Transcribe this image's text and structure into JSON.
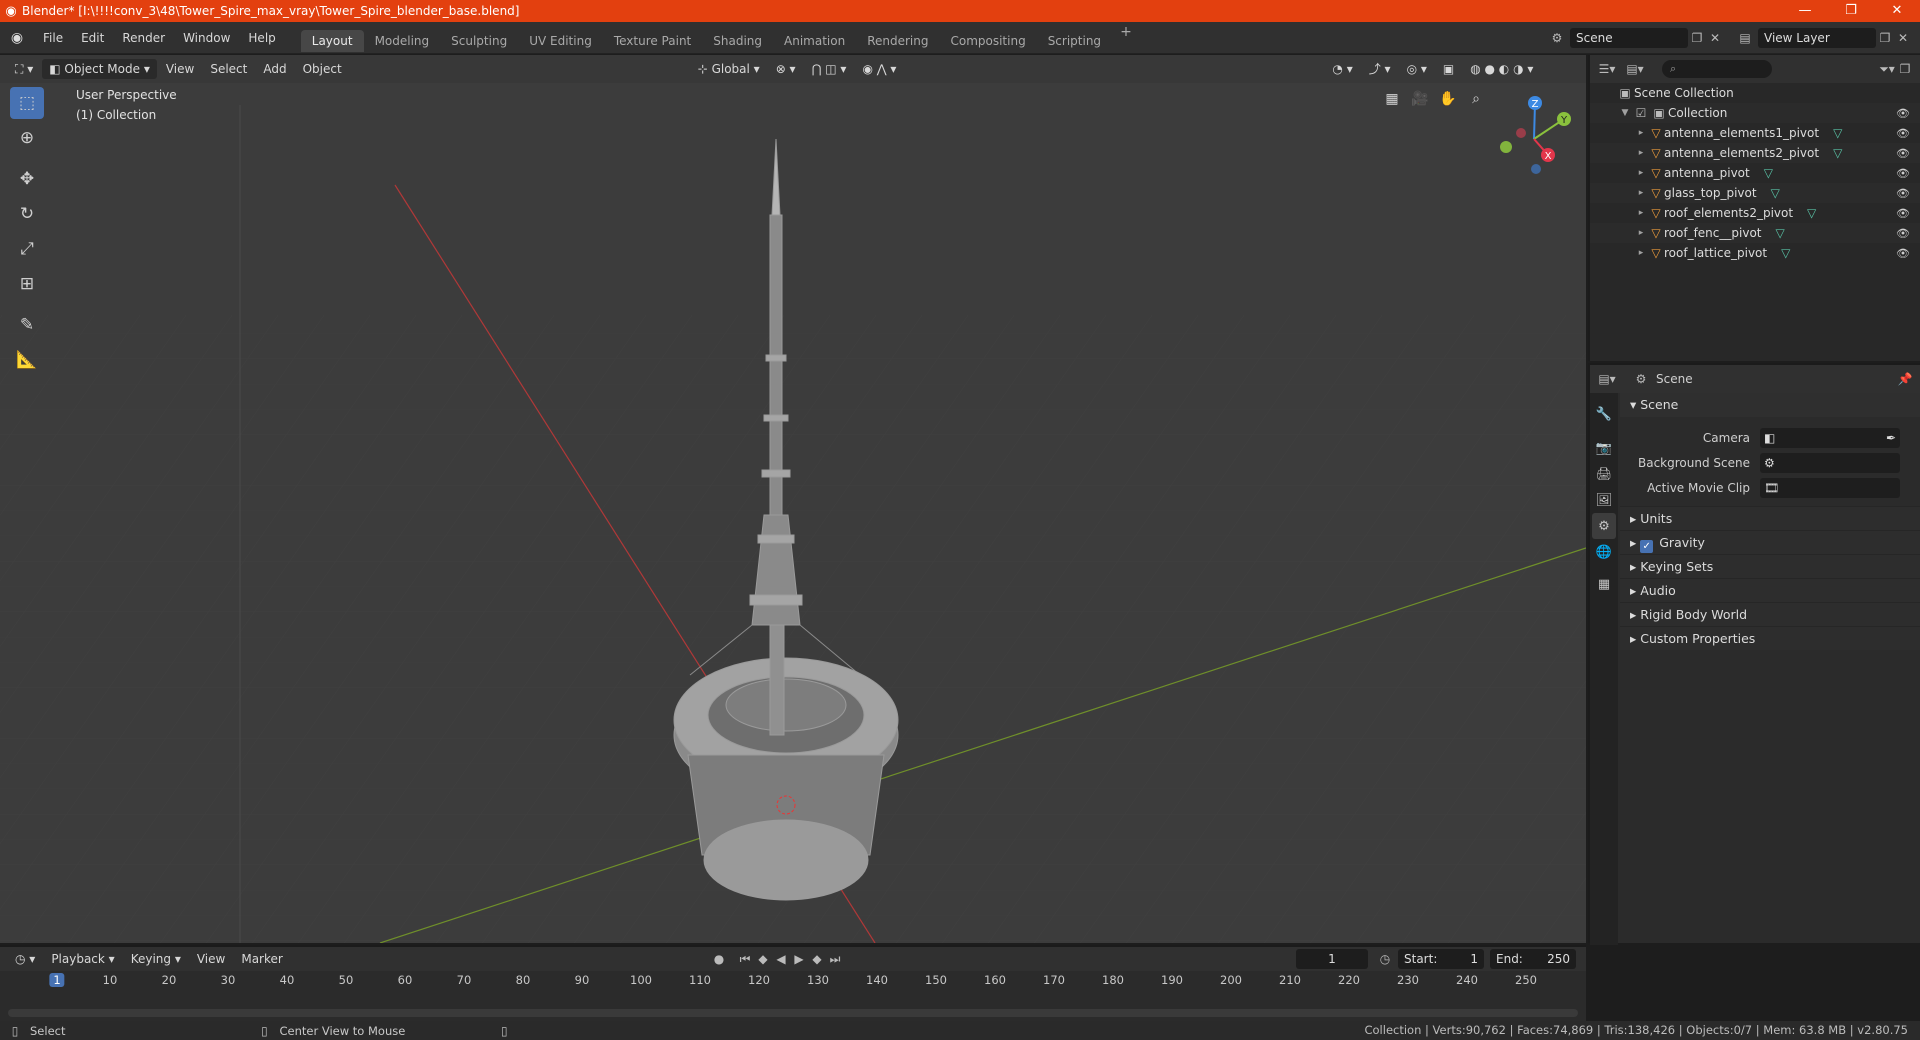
{
  "window": {
    "title": "Blender* [I:\\!!!!conv_3\\48\\Tower_Spire_max_vray\\Tower_Spire_blender_base.blend]"
  },
  "menu": [
    "File",
    "Edit",
    "Render",
    "Window",
    "Help"
  ],
  "workspaces": [
    "Layout",
    "Modeling",
    "Sculpting",
    "UV Editing",
    "Texture Paint",
    "Shading",
    "Animation",
    "Rendering",
    "Compositing",
    "Scripting"
  ],
  "active_workspace": "Layout",
  "scene_field": "Scene",
  "view_layer_field": "View Layer",
  "viewport": {
    "mode": "Object Mode",
    "menus": [
      "View",
      "Select",
      "Add",
      "Object"
    ],
    "transform": "Global",
    "info_line1": "User Perspective",
    "info_line2": "(1) Collection",
    "gizmo_axes": {
      "z": "Z",
      "y": "Y",
      "x": "X"
    }
  },
  "outliner": {
    "root": "Scene Collection",
    "collection": "Collection",
    "objects": [
      "antenna_elements1_pivot",
      "antenna_elements2_pivot",
      "antenna_pivot",
      "glass_top_pivot",
      "roof_elements2_pivot",
      "roof_fenc__pivot",
      "roof_lattice_pivot"
    ]
  },
  "properties": {
    "header": "Scene",
    "section": "Scene",
    "fields": {
      "camera_label": "Camera",
      "background_scene_label": "Background Scene",
      "active_movie_clip_label": "Active Movie Clip"
    },
    "panels": [
      "Units",
      "Gravity",
      "Keying Sets",
      "Audio",
      "Rigid Body World",
      "Custom Properties"
    ]
  },
  "timeline": {
    "menus": [
      "Playback",
      "Keying",
      "View",
      "Marker"
    ],
    "current_frame": "1",
    "start_label": "Start:",
    "start": "1",
    "end_label": "End:",
    "end": "250",
    "ticks": [
      "1",
      "10",
      "20",
      "30",
      "40",
      "50",
      "60",
      "70",
      "80",
      "90",
      "100",
      "110",
      "120",
      "130",
      "140",
      "150",
      "160",
      "170",
      "180",
      "190",
      "200",
      "210",
      "220",
      "230",
      "240",
      "250"
    ]
  },
  "statusbar": {
    "left_action": "Select",
    "middle_action": "Center View to Mouse",
    "stats": "Collection | Verts:90,762 | Faces:74,869 | Tris:138,426 | Objects:0/7 | Mem: 63.8 MB | v2.80.75"
  },
  "colors": {
    "titlebar": "#e3400f",
    "accent": "#4772b3",
    "object_icon": "#e99a3c",
    "mesh_icon": "#59c1a5",
    "axis_x": "#e3364b",
    "axis_y": "#8ac13d",
    "axis_z": "#3d8ae3"
  }
}
